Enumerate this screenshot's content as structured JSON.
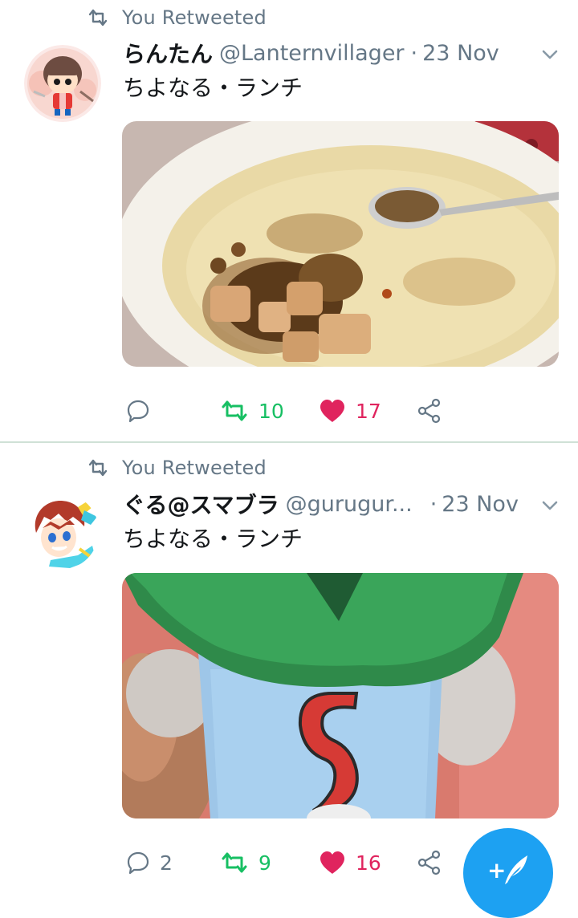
{
  "colors": {
    "accent": "#1da1f2",
    "retweet_green": "#17bf63",
    "like_red": "#e0245e",
    "muted_gray": "#657786"
  },
  "tweets": [
    {
      "retweet_label": "You Retweeted",
      "display_name": "らんたん",
      "handle": "@Lanternvillager",
      "separator": "·",
      "date": "23 Nov",
      "text": "ちよなる・ランチ",
      "avatar_icon": "chibi-character-avatar",
      "media_icon": "mapo-tofu-plate-photo",
      "actions": {
        "reply_count": "",
        "retweet_count": "10",
        "like_count": "17"
      }
    },
    {
      "retweet_label": "You Retweeted",
      "display_name": "ぐる@スマブラ",
      "handle": "@gurugur...",
      "separator": "·",
      "date": "23 Nov",
      "text": "ちよなる・ランチ",
      "avatar_icon": "anime-character-avatar",
      "media_icon": "plush-toy-photo",
      "actions": {
        "reply_count": "2",
        "retweet_count": "9",
        "like_count": "16"
      }
    }
  ],
  "fab": {
    "icon": "compose-tweet-icon",
    "plus": "+"
  }
}
